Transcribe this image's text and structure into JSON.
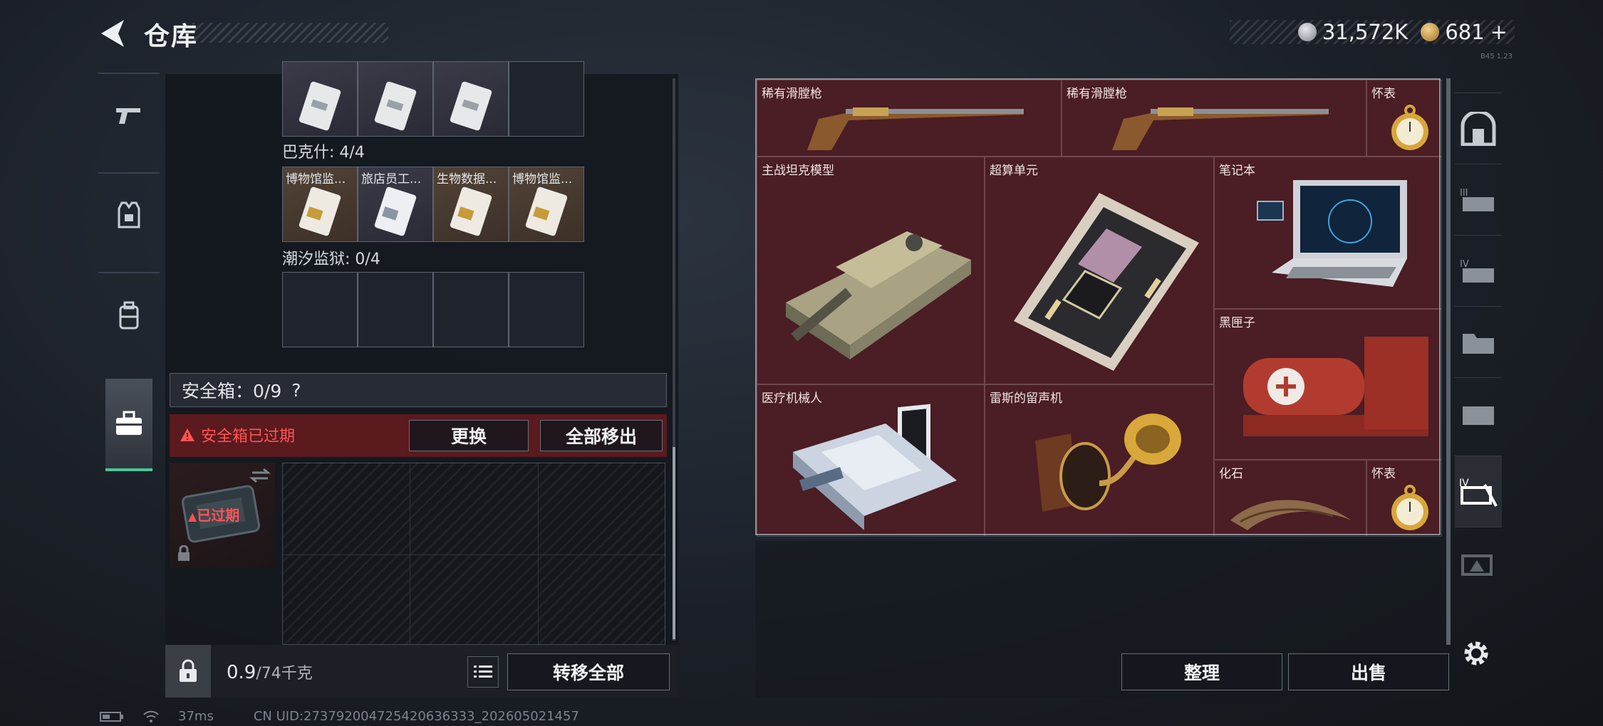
{
  "header": {
    "title": "仓库",
    "currency_silver": "31,572K",
    "currency_gold": "681",
    "gold_plus": "+",
    "version_tag": "B45 1.23"
  },
  "left_nav": {
    "items": [
      "weapon-tab",
      "armor-tab",
      "backpack-tab",
      "safebox-tab"
    ],
    "active": "safebox-tab"
  },
  "collections": [
    {
      "name": "巴克什: 4/4",
      "cells": [
        "博物馆监...",
        "旅店员工...",
        "生物数据...",
        "博物馆监..."
      ]
    },
    {
      "name": "潮汐监狱: 0/4",
      "cells": [
        "",
        "",
        "",
        ""
      ]
    }
  ],
  "safe_box": {
    "header": "安全箱：0/9",
    "help": "?",
    "expired_notice": "安全箱已过期",
    "replace_button": "更换",
    "remove_all_button": "全部移出",
    "expired_badge": "已过期"
  },
  "bottom": {
    "weight_value": "0.9",
    "weight_cap": "/74千克",
    "transfer_all_button": "转移全部"
  },
  "stash": {
    "items": [
      {
        "label": "稀有滑膛枪",
        "icon": "musket-icon"
      },
      {
        "label": "稀有滑膛枪",
        "icon": "musket-icon"
      },
      {
        "label": "怀表",
        "icon": "pocket-watch-icon"
      },
      {
        "label": "主战坦克模型",
        "icon": "tank-model-icon"
      },
      {
        "label": "超算单元",
        "icon": "supercomputer-unit-icon"
      },
      {
        "label": "笔记本",
        "icon": "laptop-icon"
      },
      {
        "label": "黑匣子",
        "icon": "black-box-icon"
      },
      {
        "label": "医疗机械人",
        "icon": "medical-robot-icon"
      },
      {
        "label": "雷斯的留声机",
        "icon": "gramophone-icon"
      },
      {
        "label": "化石",
        "icon": "fossil-icon"
      },
      {
        "label": "怀表",
        "icon": "pocket-watch-icon"
      }
    ],
    "sort_button": "整理",
    "sell_button": "出售"
  },
  "right_nav": {
    "items": [
      "stash-tab-1",
      "stash-tab-2",
      "stash-tab-3",
      "stash-tab-4",
      "stash-tab-5",
      "stash-tab-6",
      "stash-tab-7"
    ],
    "active": "stash-tab-5"
  },
  "status": {
    "ping": "37ms",
    "uid": "CN UID:273792004725420636333_202605021457"
  },
  "colors": {
    "accent_green": "#46c89a",
    "expired_red": "#ff5454",
    "stash_bg": "#4b1d24"
  }
}
